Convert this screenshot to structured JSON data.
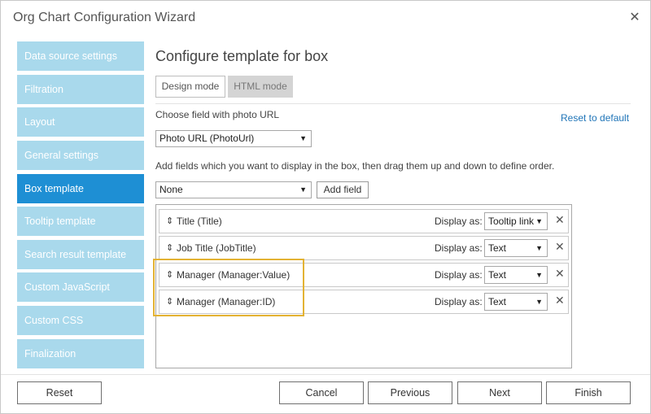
{
  "window": {
    "title": "Org Chart Configuration Wizard",
    "close_icon": "close-icon"
  },
  "sidebar": {
    "items": [
      {
        "label": "Data source settings",
        "active": false
      },
      {
        "label": "Filtration",
        "active": false
      },
      {
        "label": "Layout",
        "active": false
      },
      {
        "label": "General settings",
        "active": false
      },
      {
        "label": "Box template",
        "active": true
      },
      {
        "label": "Tooltip template",
        "active": false
      },
      {
        "label": "Search result template",
        "active": false
      },
      {
        "label": "Custom JavaScript",
        "active": false
      },
      {
        "label": "Custom CSS",
        "active": false
      },
      {
        "label": "Finalization",
        "active": false
      }
    ],
    "active_color": "#1e8fd4",
    "inactive_color": "#a9d9ec"
  },
  "main": {
    "heading": "Configure template for box",
    "modes": {
      "design": "Design mode",
      "html": "HTML mode"
    },
    "photo_label": "Choose field with photo URL",
    "reset_link": "Reset to default",
    "photo_select": "Photo URL (PhotoUrl)",
    "fields_label": "Add fields which you want to display in the box, then drag them up and down to define order.",
    "field_select": "None",
    "add_field_button": "Add field",
    "display_as_label": "Display as:",
    "rows": [
      {
        "name": "Title (Title)",
        "display": "Tooltip link"
      },
      {
        "name": "Job Title (JobTitle)",
        "display": "Text"
      },
      {
        "name": "Manager (Manager:Value)",
        "display": "Text"
      },
      {
        "name": "Manager (Manager:ID)",
        "display": "Text"
      }
    ],
    "highlight_color": "#e3b233"
  },
  "footer": {
    "reset": "Reset",
    "cancel": "Cancel",
    "previous": "Previous",
    "next": "Next",
    "finish": "Finish"
  }
}
